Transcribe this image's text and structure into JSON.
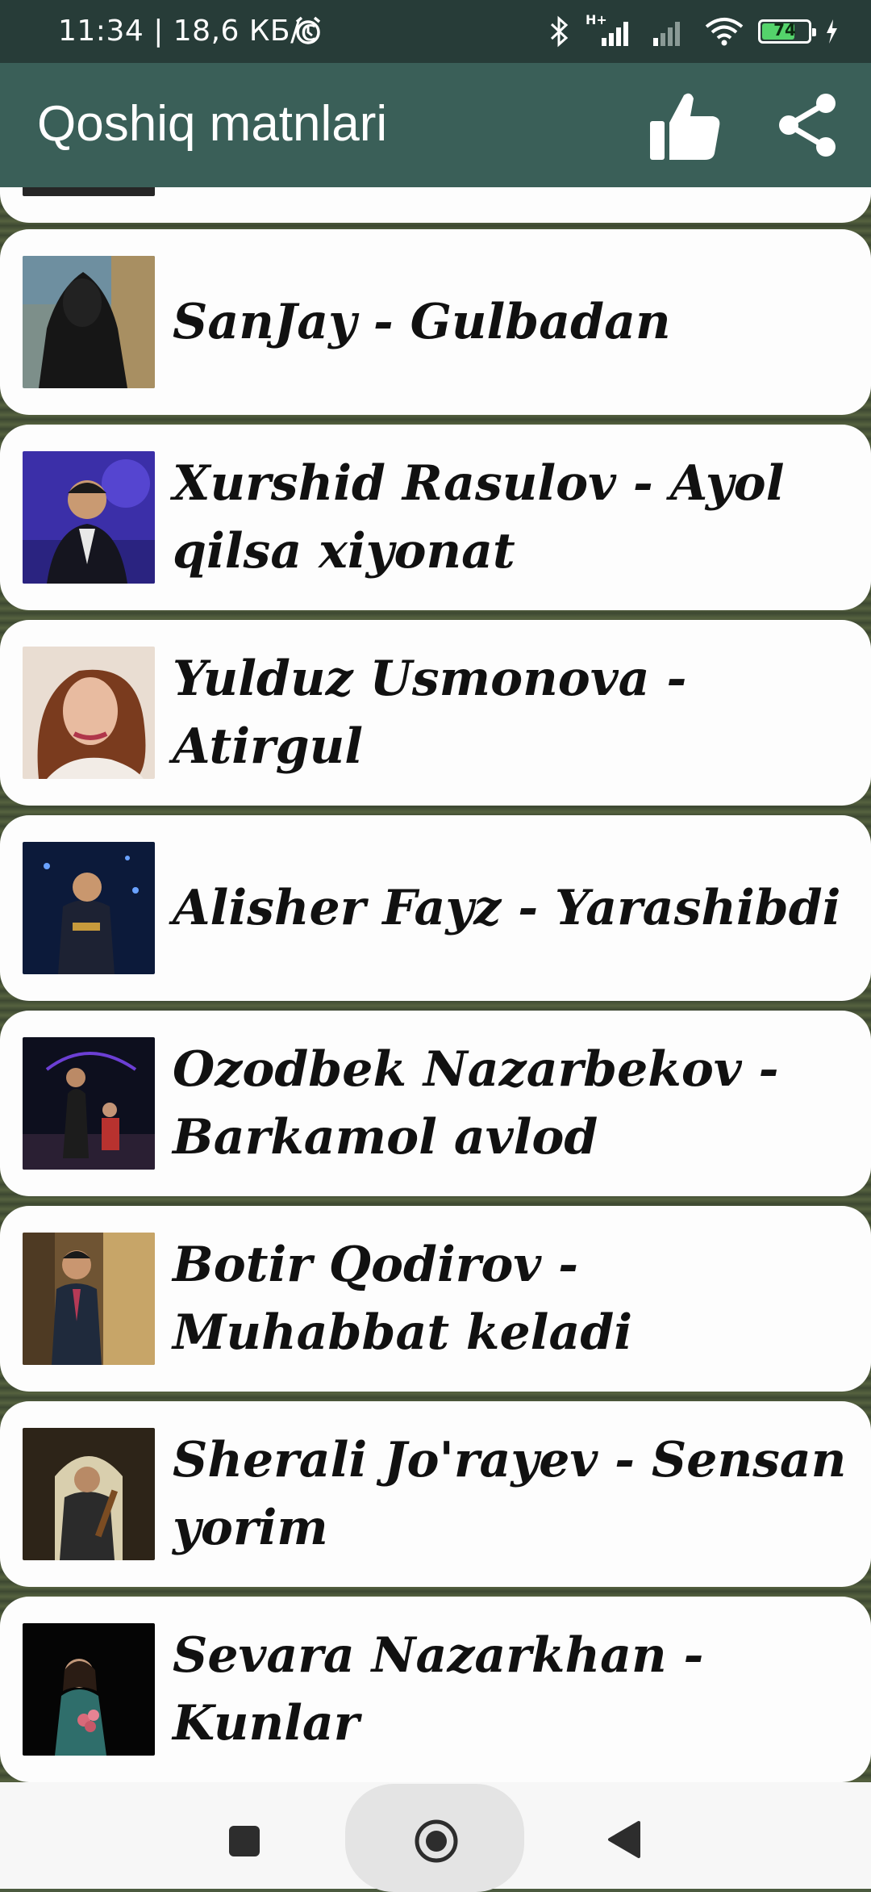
{
  "status_bar": {
    "time_speed": "11:34 | 18,6 КБ/с",
    "network_type": "H+",
    "battery_level": "74",
    "battery_percent": 74
  },
  "app_bar": {
    "title": "Qoshiq matnlari",
    "like_icon": "thumbs-up-icon",
    "share_icon": "share-icon"
  },
  "songs": [
    {
      "title": ""
    },
    {
      "title": "SanJay - Gulbadan"
    },
    {
      "title": "Xurshid Rasulov - Ayol qilsa xiyonat"
    },
    {
      "title": "Yulduz Usmonova - Atirgul"
    },
    {
      "title": "Alisher Fayz - Yarashibdi"
    },
    {
      "title": "Ozodbek Nazarbekov - Barkamol avlod"
    },
    {
      "title": "Botir Qodirov - Muhabbat keladi"
    },
    {
      "title": "Sherali Jo'rayev - Sensan yorim"
    },
    {
      "title": "Sevara Nazarkhan - Kunlar"
    }
  ],
  "nav_bar": {
    "recent_icon": "square-recents-icon",
    "home_icon": "circle-home-icon",
    "back_icon": "triangle-back-icon"
  }
}
